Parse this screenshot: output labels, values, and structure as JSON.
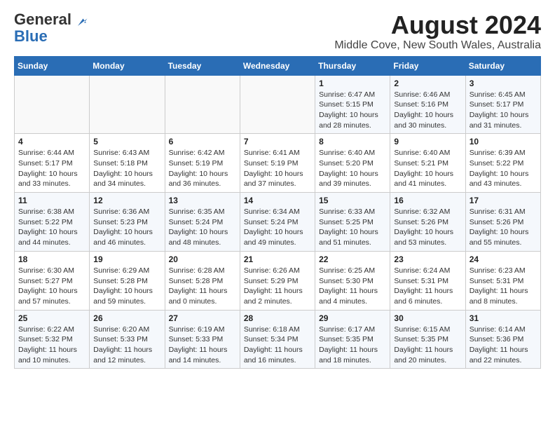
{
  "header": {
    "logo_general": "General",
    "logo_blue": "Blue",
    "title": "August 2024",
    "subtitle": "Middle Cove, New South Wales, Australia"
  },
  "columns": [
    "Sunday",
    "Monday",
    "Tuesday",
    "Wednesday",
    "Thursday",
    "Friday",
    "Saturday"
  ],
  "weeks": [
    [
      {
        "day": "",
        "info": ""
      },
      {
        "day": "",
        "info": ""
      },
      {
        "day": "",
        "info": ""
      },
      {
        "day": "",
        "info": ""
      },
      {
        "day": "1",
        "info": "Sunrise: 6:47 AM\nSunset: 5:15 PM\nDaylight: 10 hours\nand 28 minutes."
      },
      {
        "day": "2",
        "info": "Sunrise: 6:46 AM\nSunset: 5:16 PM\nDaylight: 10 hours\nand 30 minutes."
      },
      {
        "day": "3",
        "info": "Sunrise: 6:45 AM\nSunset: 5:17 PM\nDaylight: 10 hours\nand 31 minutes."
      }
    ],
    [
      {
        "day": "4",
        "info": "Sunrise: 6:44 AM\nSunset: 5:17 PM\nDaylight: 10 hours\nand 33 minutes."
      },
      {
        "day": "5",
        "info": "Sunrise: 6:43 AM\nSunset: 5:18 PM\nDaylight: 10 hours\nand 34 minutes."
      },
      {
        "day": "6",
        "info": "Sunrise: 6:42 AM\nSunset: 5:19 PM\nDaylight: 10 hours\nand 36 minutes."
      },
      {
        "day": "7",
        "info": "Sunrise: 6:41 AM\nSunset: 5:19 PM\nDaylight: 10 hours\nand 37 minutes."
      },
      {
        "day": "8",
        "info": "Sunrise: 6:40 AM\nSunset: 5:20 PM\nDaylight: 10 hours\nand 39 minutes."
      },
      {
        "day": "9",
        "info": "Sunrise: 6:40 AM\nSunset: 5:21 PM\nDaylight: 10 hours\nand 41 minutes."
      },
      {
        "day": "10",
        "info": "Sunrise: 6:39 AM\nSunset: 5:22 PM\nDaylight: 10 hours\nand 43 minutes."
      }
    ],
    [
      {
        "day": "11",
        "info": "Sunrise: 6:38 AM\nSunset: 5:22 PM\nDaylight: 10 hours\nand 44 minutes."
      },
      {
        "day": "12",
        "info": "Sunrise: 6:36 AM\nSunset: 5:23 PM\nDaylight: 10 hours\nand 46 minutes."
      },
      {
        "day": "13",
        "info": "Sunrise: 6:35 AM\nSunset: 5:24 PM\nDaylight: 10 hours\nand 48 minutes."
      },
      {
        "day": "14",
        "info": "Sunrise: 6:34 AM\nSunset: 5:24 PM\nDaylight: 10 hours\nand 49 minutes."
      },
      {
        "day": "15",
        "info": "Sunrise: 6:33 AM\nSunset: 5:25 PM\nDaylight: 10 hours\nand 51 minutes."
      },
      {
        "day": "16",
        "info": "Sunrise: 6:32 AM\nSunset: 5:26 PM\nDaylight: 10 hours\nand 53 minutes."
      },
      {
        "day": "17",
        "info": "Sunrise: 6:31 AM\nSunset: 5:26 PM\nDaylight: 10 hours\nand 55 minutes."
      }
    ],
    [
      {
        "day": "18",
        "info": "Sunrise: 6:30 AM\nSunset: 5:27 PM\nDaylight: 10 hours\nand 57 minutes."
      },
      {
        "day": "19",
        "info": "Sunrise: 6:29 AM\nSunset: 5:28 PM\nDaylight: 10 hours\nand 59 minutes."
      },
      {
        "day": "20",
        "info": "Sunrise: 6:28 AM\nSunset: 5:28 PM\nDaylight: 11 hours\nand 0 minutes."
      },
      {
        "day": "21",
        "info": "Sunrise: 6:26 AM\nSunset: 5:29 PM\nDaylight: 11 hours\nand 2 minutes."
      },
      {
        "day": "22",
        "info": "Sunrise: 6:25 AM\nSunset: 5:30 PM\nDaylight: 11 hours\nand 4 minutes."
      },
      {
        "day": "23",
        "info": "Sunrise: 6:24 AM\nSunset: 5:31 PM\nDaylight: 11 hours\nand 6 minutes."
      },
      {
        "day": "24",
        "info": "Sunrise: 6:23 AM\nSunset: 5:31 PM\nDaylight: 11 hours\nand 8 minutes."
      }
    ],
    [
      {
        "day": "25",
        "info": "Sunrise: 6:22 AM\nSunset: 5:32 PM\nDaylight: 11 hours\nand 10 minutes."
      },
      {
        "day": "26",
        "info": "Sunrise: 6:20 AM\nSunset: 5:33 PM\nDaylight: 11 hours\nand 12 minutes."
      },
      {
        "day": "27",
        "info": "Sunrise: 6:19 AM\nSunset: 5:33 PM\nDaylight: 11 hours\nand 14 minutes."
      },
      {
        "day": "28",
        "info": "Sunrise: 6:18 AM\nSunset: 5:34 PM\nDaylight: 11 hours\nand 16 minutes."
      },
      {
        "day": "29",
        "info": "Sunrise: 6:17 AM\nSunset: 5:35 PM\nDaylight: 11 hours\nand 18 minutes."
      },
      {
        "day": "30",
        "info": "Sunrise: 6:15 AM\nSunset: 5:35 PM\nDaylight: 11 hours\nand 20 minutes."
      },
      {
        "day": "31",
        "info": "Sunrise: 6:14 AM\nSunset: 5:36 PM\nDaylight: 11 hours\nand 22 minutes."
      }
    ]
  ]
}
